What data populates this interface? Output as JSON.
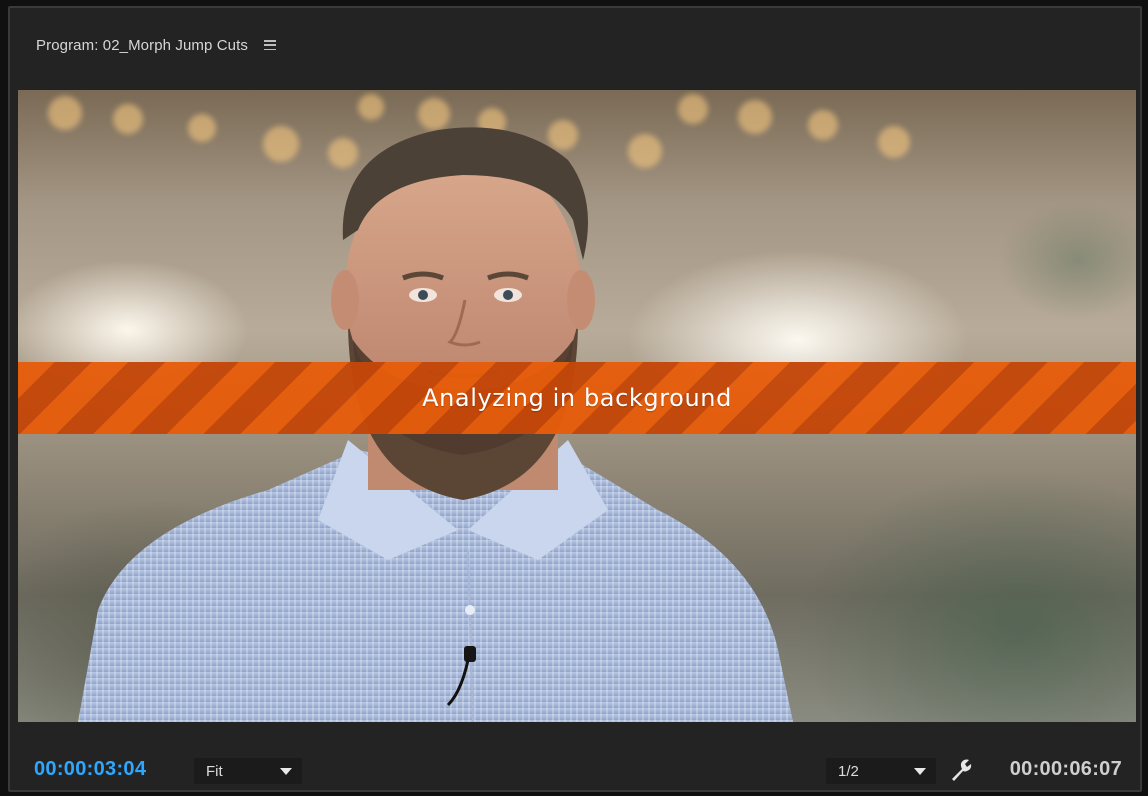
{
  "panel": {
    "title": "Program: 02_Morph Jump Cuts",
    "menu_icon": "hamburger-menu-icon"
  },
  "viewer": {
    "overlay_text": "Analyzing in background",
    "overlay_color": "#e65c0a"
  },
  "footer": {
    "current_timecode": "00:00:03:04",
    "current_timecode_color": "#2ea8ff",
    "zoom": {
      "selected": "Fit"
    },
    "resolution": {
      "selected": "1/2"
    },
    "settings_icon": "wrench-icon",
    "duration_timecode": "00:00:06:07"
  }
}
